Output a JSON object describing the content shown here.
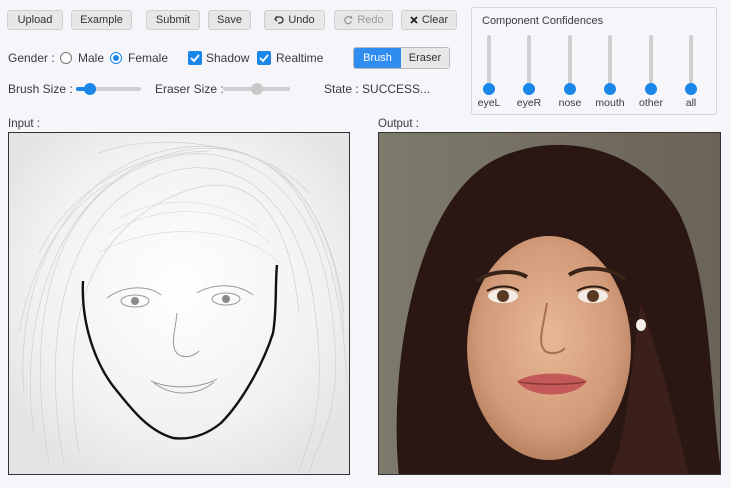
{
  "toolbar": {
    "upload": "Upload",
    "example": "Example",
    "submit": "Submit",
    "save": "Save",
    "undo": "Undo",
    "redo": "Redo",
    "clear": "Clear"
  },
  "options": {
    "gender_label": "Gender :",
    "male": "Male",
    "female": "Female",
    "gender_selected": "Female",
    "shadow": "Shadow",
    "shadow_checked": true,
    "realtime": "Realtime",
    "realtime_checked": true,
    "brush": "Brush",
    "eraser": "Eraser",
    "active_tool": "Brush"
  },
  "sizes": {
    "brush_label": "Brush Size :",
    "brush_value": 0.22,
    "eraser_label": "Eraser Size :",
    "eraser_value": 0.5,
    "state_label": "State : SUCCESS..."
  },
  "confidences": {
    "title": "Component Confidences",
    "items": [
      {
        "label": "eyeL",
        "value": 0
      },
      {
        "label": "eyeR",
        "value": 0
      },
      {
        "label": "nose",
        "value": 0
      },
      {
        "label": "mouth",
        "value": 0
      },
      {
        "label": "other",
        "value": 0
      },
      {
        "label": "all",
        "value": 0
      }
    ]
  },
  "input_label": "Input :",
  "output_label": "Output :",
  "colors": {
    "accent": "#1a86e8",
    "background": "#f6f5fa"
  },
  "icons": {
    "undo": "undo-icon",
    "redo": "redo-icon",
    "clear": "clear-x-icon",
    "check": "check-icon"
  }
}
